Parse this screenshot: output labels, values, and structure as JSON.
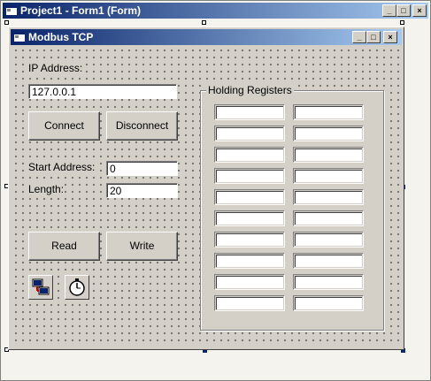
{
  "ide_window": {
    "title": "Project1 - Form1 (Form)"
  },
  "form": {
    "title": "Modbus TCP",
    "ip_label": "IP Address:",
    "ip_value": "127.0.0.1",
    "connect_label": "Connect",
    "disconnect_label": "Disconnect",
    "start_address_label": "Start Address:",
    "start_address_value": "0",
    "length_label": "Length:",
    "length_value": "20",
    "read_label": "Read",
    "write_label": "Write",
    "holding_registers_label": "Holding Registers",
    "register_count": 20,
    "icons": [
      "winsock-control-icon",
      "timer-control-icon"
    ]
  },
  "caption_buttons": {
    "minimize": "_",
    "maximize": "□",
    "close": "×"
  },
  "colors": {
    "title_start": "#0a246a",
    "title_end": "#a6caf0",
    "face": "#d4d0c8"
  }
}
